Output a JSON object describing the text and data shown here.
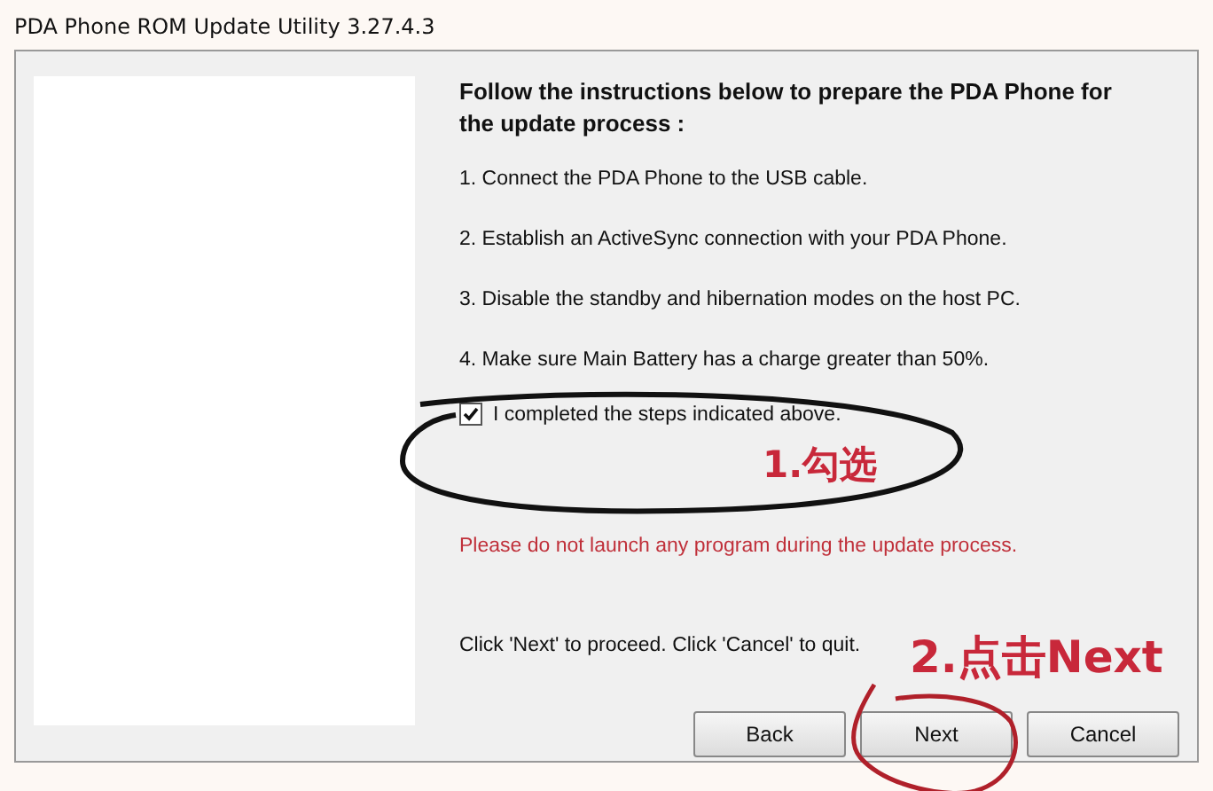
{
  "window": {
    "title": "PDA Phone ROM Update Utility 3.27.4.3"
  },
  "heading": "Follow the instructions below to prepare the PDA Phone for the update process :",
  "steps": [
    "1. Connect the PDA Phone to the USB cable.",
    "2. Establish an ActiveSync connection with your PDA Phone.",
    "3. Disable the standby and hibernation modes on the host PC.",
    "4. Make sure Main Battery has a charge greater than 50%."
  ],
  "confirm": {
    "label": "I completed the steps indicated above.",
    "checked": true
  },
  "warning": "Please do not launch any program during the update process.",
  "hint": "Click 'Next' to proceed. Click 'Cancel' to quit.",
  "buttons": [
    "Back",
    "Next",
    "Cancel"
  ],
  "annotations": [
    {
      "kind": "ellipse",
      "text": "1.勾选"
    },
    {
      "kind": "scribble",
      "text": "2.点击Next"
    }
  ]
}
